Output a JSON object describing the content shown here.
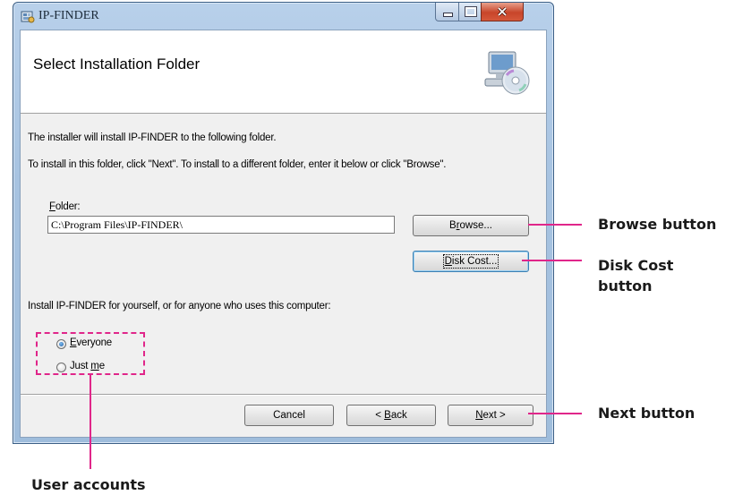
{
  "window": {
    "title": "IP-FINDER",
    "controls": {
      "minimize": "minimize",
      "maximize": "maximize",
      "close": "close"
    }
  },
  "banner": {
    "title": "Select Installation Folder",
    "icon": "computer-disc-icon"
  },
  "body": {
    "intro": "The installer will install IP-FINDER to the following folder.",
    "instructions": "To install in this folder, click \"Next\". To install to a different folder, enter it below or click \"Browse\".",
    "folder_label_accel": "F",
    "folder_label_rest": "older:",
    "folder_value": "C:\\Program Files\\IP-FINDER\\",
    "browse_accel": "r",
    "browse_pre": "B",
    "browse_post": "owse...",
    "diskcost_accel": "D",
    "diskcost_rest": "isk Cost...",
    "install_for": "Install IP-FINDER for yourself, or for anyone who uses this computer:",
    "radio_everyone_accel": "E",
    "radio_everyone_rest": "veryone",
    "radio_justme_pre": "Just ",
    "radio_justme_accel": "m",
    "radio_justme_post": "e",
    "selected": "Everyone"
  },
  "footer": {
    "cancel": "Cancel",
    "back_pre": "< ",
    "back_accel": "B",
    "back_rest": "ack",
    "next_accel": "N",
    "next_rest": "ext >"
  },
  "annotations": {
    "browse": "Browse button",
    "diskcost_line1": "Disk Cost",
    "diskcost_line2": "button",
    "next": "Next button",
    "users": "User accounts",
    "color": "#e0268a"
  }
}
